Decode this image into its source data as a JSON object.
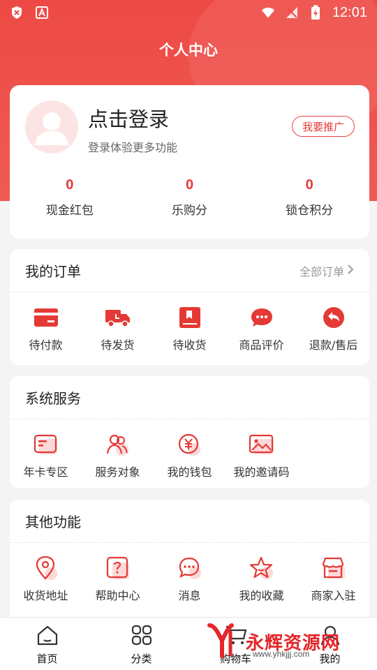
{
  "status_bar": {
    "time": "12:01"
  },
  "header": {
    "title": "个人中心"
  },
  "profile": {
    "login_title": "点击登录",
    "login_subtitle": "登录体验更多功能",
    "promote_label": "我要推广"
  },
  "stats": [
    {
      "value": "0",
      "label": "现金红包"
    },
    {
      "value": "0",
      "label": "乐购分"
    },
    {
      "value": "0",
      "label": "锁仓积分"
    }
  ],
  "orders": {
    "title": "我的订单",
    "all_label": "全部订单",
    "items": [
      {
        "label": "待付款",
        "icon": "card-icon"
      },
      {
        "label": "待发货",
        "icon": "truck-icon"
      },
      {
        "label": "待收货",
        "icon": "package-icon"
      },
      {
        "label": "商品评价",
        "icon": "chat-icon"
      },
      {
        "label": "退款/售后",
        "icon": "return-icon"
      }
    ]
  },
  "services": {
    "title": "系统服务",
    "items": [
      {
        "label": "年卡专区",
        "icon": "annual-card-icon"
      },
      {
        "label": "服务对象",
        "icon": "users-icon"
      },
      {
        "label": "我的钱包",
        "icon": "yen-wallet-icon"
      },
      {
        "label": "我的邀请码",
        "icon": "image-icon"
      }
    ]
  },
  "others": {
    "title": "其他功能",
    "items": [
      {
        "label": "收货地址",
        "icon": "location-icon"
      },
      {
        "label": "帮助中心",
        "icon": "help-icon"
      },
      {
        "label": "消息",
        "icon": "message-icon"
      },
      {
        "label": "我的收藏",
        "icon": "star-icon"
      },
      {
        "label": "商家入驻",
        "icon": "store-icon"
      }
    ]
  },
  "tabbar": [
    {
      "label": "首页",
      "icon": "home-icon"
    },
    {
      "label": "分类",
      "icon": "grid-icon"
    },
    {
      "label": "购物车",
      "icon": "cart-icon"
    },
    {
      "label": "我的",
      "icon": "user-icon"
    }
  ],
  "watermark": {
    "text": "永辉资源网",
    "url": "www.yhkjjj.com"
  },
  "colors": {
    "primary": "#e53935",
    "header_bg": "#ee4a45",
    "page_bg": "#f4f4f4"
  }
}
